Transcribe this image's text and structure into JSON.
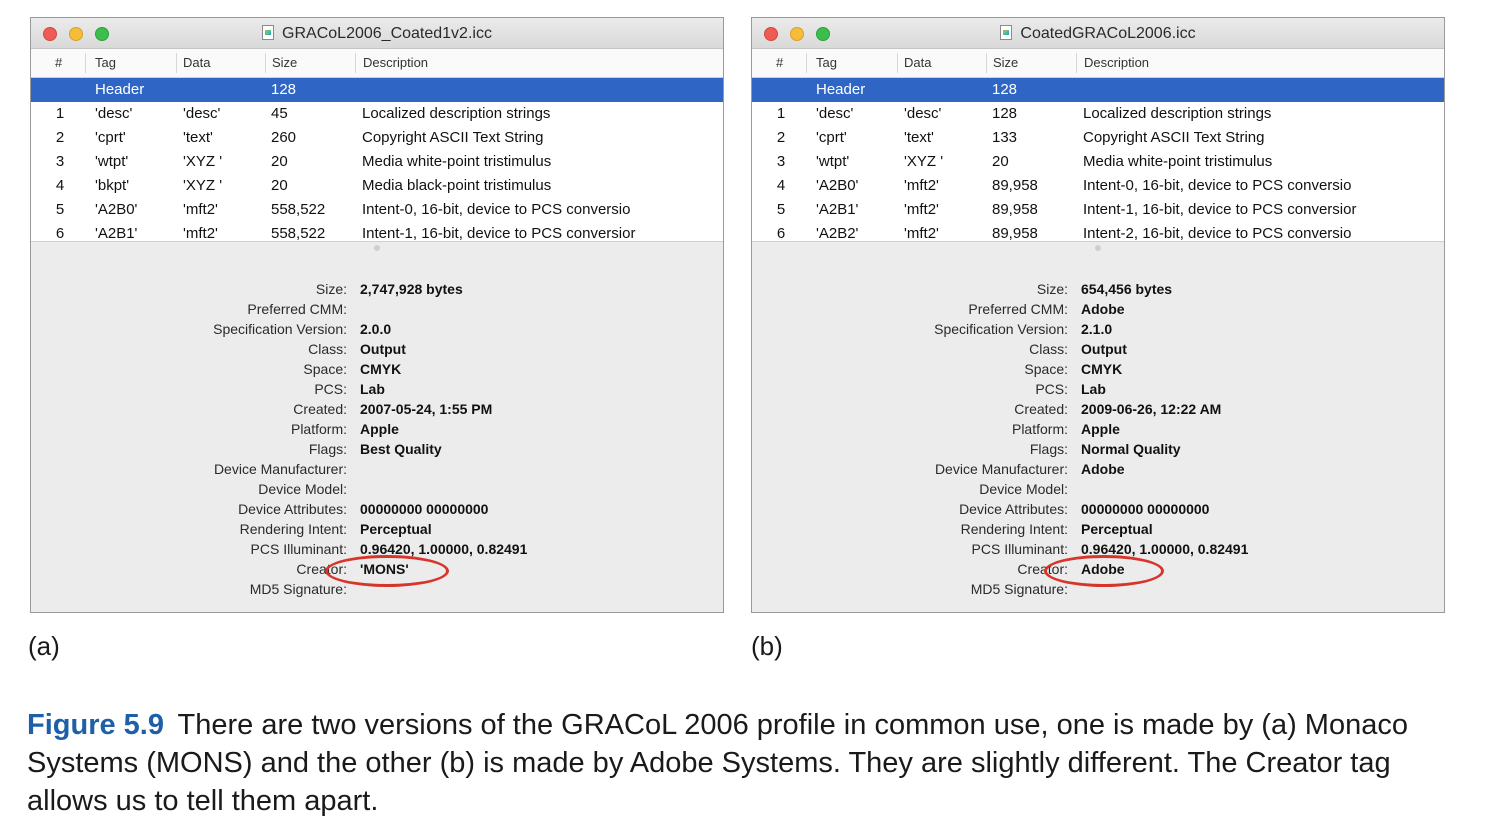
{
  "windows": [
    {
      "title": "GRACoL2006_Coated1v2.icc",
      "columns": [
        "#",
        "Tag",
        "Data",
        "Size",
        "Description"
      ],
      "header_row": {
        "num": "",
        "tag": "Header",
        "data": "",
        "size": "128",
        "desc": ""
      },
      "rows": [
        {
          "num": "1",
          "tag": "'desc'",
          "data": "'desc'",
          "size": "45",
          "desc": "Localized description strings"
        },
        {
          "num": "2",
          "tag": "'cprt'",
          "data": "'text'",
          "size": "260",
          "desc": "Copyright ASCII Text String"
        },
        {
          "num": "3",
          "tag": "'wtpt'",
          "data": "'XYZ '",
          "size": "20",
          "desc": "Media white-point tristimulus"
        },
        {
          "num": "4",
          "tag": "'bkpt'",
          "data": "'XYZ '",
          "size": "20",
          "desc": "Media black-point tristimulus"
        },
        {
          "num": "5",
          "tag": "'A2B0'",
          "data": "'mft2'",
          "size": "558,522",
          "desc": "Intent-0, 16-bit, device to PCS conversio"
        },
        {
          "num": "6",
          "tag": "'A2B1'",
          "data": "'mft2'",
          "size": "558,522",
          "desc": "Intent-1, 16-bit, device to PCS conversior"
        }
      ],
      "info": [
        {
          "label": "Size:",
          "value": "2,747,928 bytes"
        },
        {
          "label": "Preferred CMM:",
          "value": ""
        },
        {
          "label": "Specification Version:",
          "value": "2.0.0"
        },
        {
          "label": "Class:",
          "value": "Output"
        },
        {
          "label": "Space:",
          "value": "CMYK"
        },
        {
          "label": "PCS:",
          "value": "Lab"
        },
        {
          "label": "Created:",
          "value": "2007-05-24, 1:55 PM"
        },
        {
          "label": "Platform:",
          "value": "Apple"
        },
        {
          "label": "Flags:",
          "value": "Best Quality"
        },
        {
          "label": "Device Manufacturer:",
          "value": ""
        },
        {
          "label": "Device Model:",
          "value": ""
        },
        {
          "label": "Device Attributes:",
          "value": "00000000 00000000"
        },
        {
          "label": "Rendering Intent:",
          "value": "Perceptual"
        },
        {
          "label": "PCS Illuminant:",
          "value": "0.96420, 1.00000, 0.82491"
        },
        {
          "label": "Creator:",
          "value": "'MONS'"
        },
        {
          "label": "MD5 Signature:",
          "value": ""
        }
      ]
    },
    {
      "title": "CoatedGRACoL2006.icc",
      "columns": [
        "#",
        "Tag",
        "Data",
        "Size",
        "Description"
      ],
      "header_row": {
        "num": "",
        "tag": "Header",
        "data": "",
        "size": "128",
        "desc": ""
      },
      "rows": [
        {
          "num": "1",
          "tag": "'desc'",
          "data": "'desc'",
          "size": "128",
          "desc": "Localized description strings"
        },
        {
          "num": "2",
          "tag": "'cprt'",
          "data": "'text'",
          "size": "133",
          "desc": "Copyright ASCII Text String"
        },
        {
          "num": "3",
          "tag": "'wtpt'",
          "data": "'XYZ '",
          "size": "20",
          "desc": "Media white-point tristimulus"
        },
        {
          "num": "4",
          "tag": "'A2B0'",
          "data": "'mft2'",
          "size": "89,958",
          "desc": "Intent-0, 16-bit, device to PCS conversio"
        },
        {
          "num": "5",
          "tag": "'A2B1'",
          "data": "'mft2'",
          "size": "89,958",
          "desc": "Intent-1, 16-bit, device to PCS conversior"
        },
        {
          "num": "6",
          "tag": "'A2B2'",
          "data": "'mft2'",
          "size": "89,958",
          "desc": "Intent-2, 16-bit, device to PCS conversio"
        }
      ],
      "info": [
        {
          "label": "Size:",
          "value": "654,456 bytes"
        },
        {
          "label": "Preferred CMM:",
          "value": "Adobe"
        },
        {
          "label": "Specification Version:",
          "value": "2.1.0"
        },
        {
          "label": "Class:",
          "value": "Output"
        },
        {
          "label": "Space:",
          "value": "CMYK"
        },
        {
          "label": "PCS:",
          "value": "Lab"
        },
        {
          "label": "Created:",
          "value": "2009-06-26, 12:22 AM"
        },
        {
          "label": "Platform:",
          "value": "Apple"
        },
        {
          "label": "Flags:",
          "value": "Normal Quality"
        },
        {
          "label": "Device Manufacturer:",
          "value": "Adobe"
        },
        {
          "label": "Device Model:",
          "value": ""
        },
        {
          "label": "Device Attributes:",
          "value": "00000000 00000000"
        },
        {
          "label": "Rendering Intent:",
          "value": "Perceptual"
        },
        {
          "label": "PCS Illuminant:",
          "value": "0.96420, 1.00000, 0.82491"
        },
        {
          "label": "Creator:",
          "value": "Adobe"
        },
        {
          "label": "MD5 Signature:",
          "value": ""
        }
      ]
    }
  ],
  "panel_labels": [
    "(a)",
    "(b)"
  ],
  "caption": {
    "figure_number": "Figure 5.9",
    "text": "There are two versions of the GRACoL 2006 profile in common use, one is made by (a) Monaco Systems (MONS) and the other (b) is made by Adobe Systems. They are slightly different. The Creator tag allows us to tell them apart."
  },
  "colors": {
    "selection": "#2f66c5",
    "highlight": "#d8352a",
    "figure_number": "#1f5fa8"
  }
}
